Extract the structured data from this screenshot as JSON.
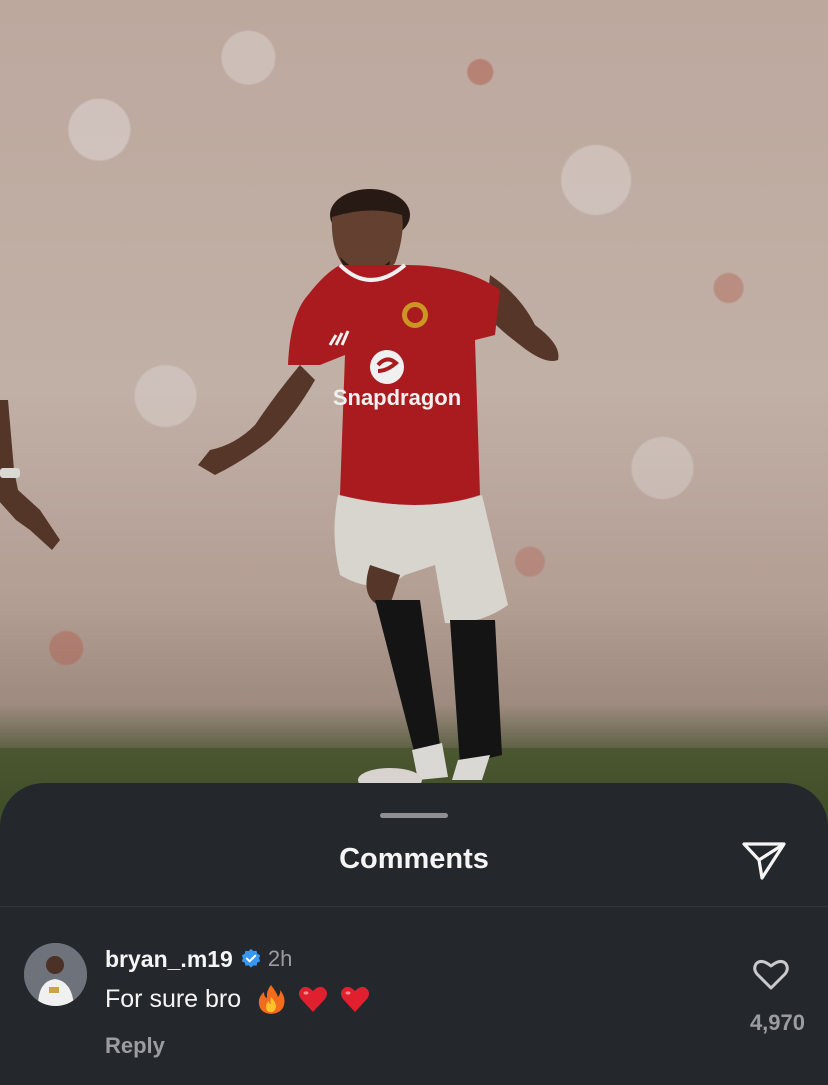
{
  "sheet": {
    "title": "Comments"
  },
  "comment": {
    "username": "bryan_.m19",
    "verified": true,
    "time": "2h",
    "text": "For sure bro",
    "emojis": [
      "fire-emoji",
      "red-heart-emoji",
      "red-heart-emoji"
    ],
    "reply_label": "Reply",
    "like_count": "4,970"
  },
  "shirt": {
    "sponsor": "Snapdragon"
  },
  "colors": {
    "sheet_background": "#24272b",
    "primary_text": "#f5f5f5",
    "secondary_text": "#9a9ca1",
    "verified_badge": "#3897f0",
    "shirt_red": "#b51d23"
  }
}
